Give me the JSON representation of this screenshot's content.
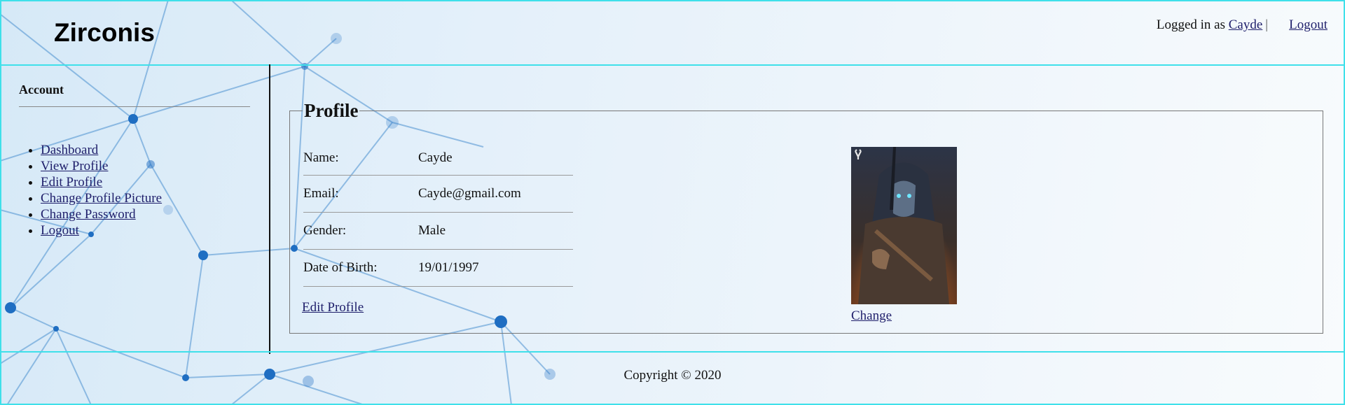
{
  "header": {
    "logo": "Zirconis",
    "logged_in_prefix": "Logged in as",
    "username": "Cayde",
    "separator": "|",
    "logout": "Logout"
  },
  "sidebar": {
    "title": "Account",
    "items": [
      {
        "label": "Dashboard"
      },
      {
        "label": "View Profile"
      },
      {
        "label": "Edit Profile"
      },
      {
        "label": "Change Profile Picture"
      },
      {
        "label": "Change Password"
      },
      {
        "label": "Logout"
      }
    ]
  },
  "profile": {
    "legend": "Profile",
    "fields": [
      {
        "label": "Name:",
        "value": "Cayde"
      },
      {
        "label": "Email:",
        "value": "Cayde@gmail.com"
      },
      {
        "label": "Gender:",
        "value": "Male"
      },
      {
        "label": "Date of Birth:",
        "value": "19/01/1997"
      }
    ],
    "edit_link": "Edit Profile",
    "change_link": "Change"
  },
  "footer": {
    "copyright": "Copyright © 2020"
  },
  "colors": {
    "frame_border": "#3fe0ea",
    "link": "#1f1f6b",
    "network_line": "#4a8fd0",
    "network_node": "#1f6ec2"
  }
}
